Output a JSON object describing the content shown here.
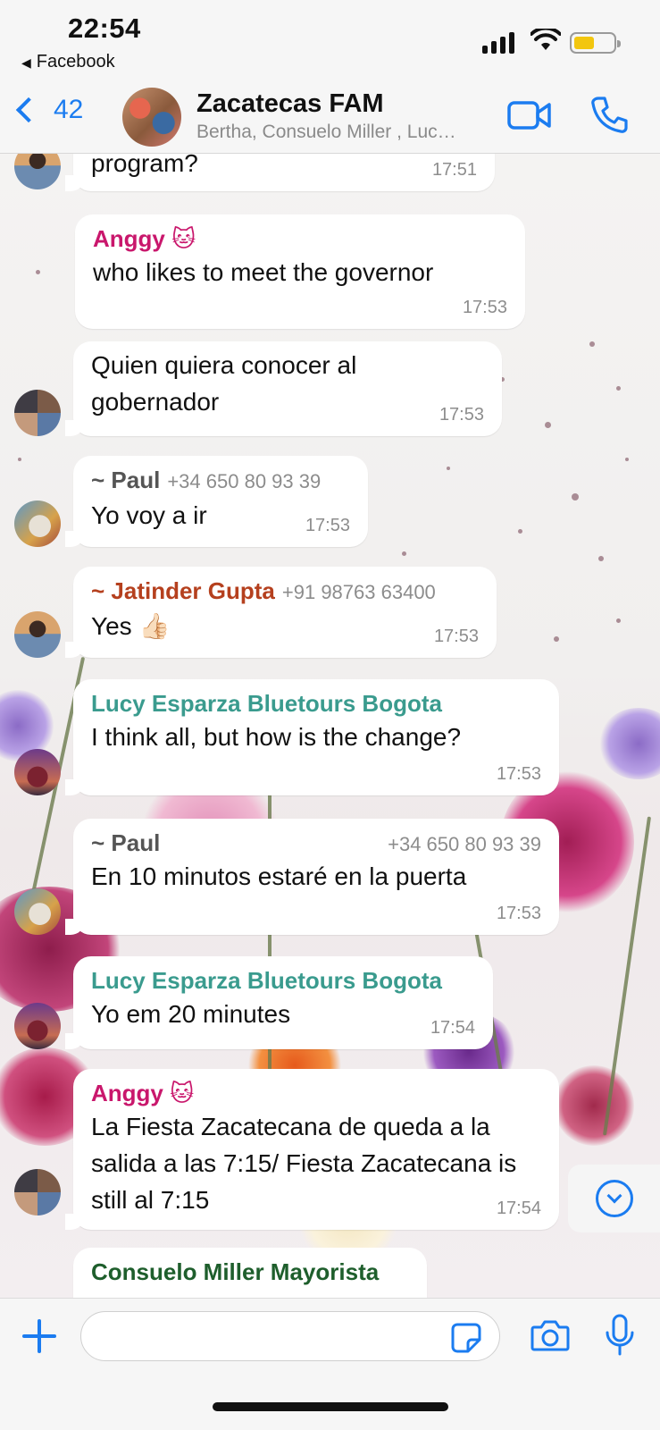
{
  "status_bar": {
    "time": "22:54",
    "back_app": "Facebook"
  },
  "header": {
    "back_count": "42",
    "title": "Zacatecas FAM",
    "subtitle": "Bertha, Consuelo Miller , Luc…"
  },
  "colors": {
    "accent": "#1b7cf0",
    "anggy": "#c9176c",
    "paul": "#555555",
    "jatinder": "#b5401e",
    "lucy": "#3a9b8e",
    "consuelo": "#1e5e2c",
    "battery": "#f2c60f"
  },
  "messages": [
    {
      "sender": "",
      "phone": "",
      "text": "program?",
      "time": "17:51"
    },
    {
      "sender": "Anggy 🐱",
      "phone": "",
      "text": "who likes to meet the governor",
      "time": "17:53"
    },
    {
      "sender": "",
      "phone": "",
      "text": "Quien quiera conocer al gobernador",
      "time": "17:53"
    },
    {
      "sender": "~ Paul",
      "phone": "+34 650 80 93 39",
      "text": "Yo voy a ir",
      "time": "17:53"
    },
    {
      "sender": "~ Jatinder Gupta",
      "phone": "+91 98763 63400",
      "text": "Yes 👍🏻",
      "time": "17:53"
    },
    {
      "sender": "Lucy Esparza  Bluetours Bogota",
      "phone": "",
      "text": "I think all, but how is the change?",
      "time": "17:53"
    },
    {
      "sender": "~ Paul",
      "phone": "+34 650 80 93 39",
      "text": "En 10 minutos estaré en la puerta",
      "time": "17:53"
    },
    {
      "sender": "Lucy Esparza  Bluetours Bogota",
      "phone": "",
      "text": "Yo em 20 minutes",
      "time": "17:54"
    },
    {
      "sender": "Anggy 🐱",
      "phone": "",
      "text": "La Fiesta Zacatecana de queda a la salida a las 7:15/ Fiesta Zacatecana is still al 7:15",
      "time": "17:54"
    },
    {
      "sender": "Consuelo Miller  Mayorista",
      "phone": "",
      "text": "",
      "time": ""
    }
  ],
  "icons": {
    "back": "chevron-left-icon",
    "video": "video-camera-icon",
    "call": "phone-icon",
    "scroll": "chevron-down-icon",
    "attach": "plus-icon",
    "sticker": "sticker-icon",
    "camera": "camera-icon",
    "mic": "microphone-icon"
  },
  "input": {
    "value": "",
    "placeholder": ""
  }
}
